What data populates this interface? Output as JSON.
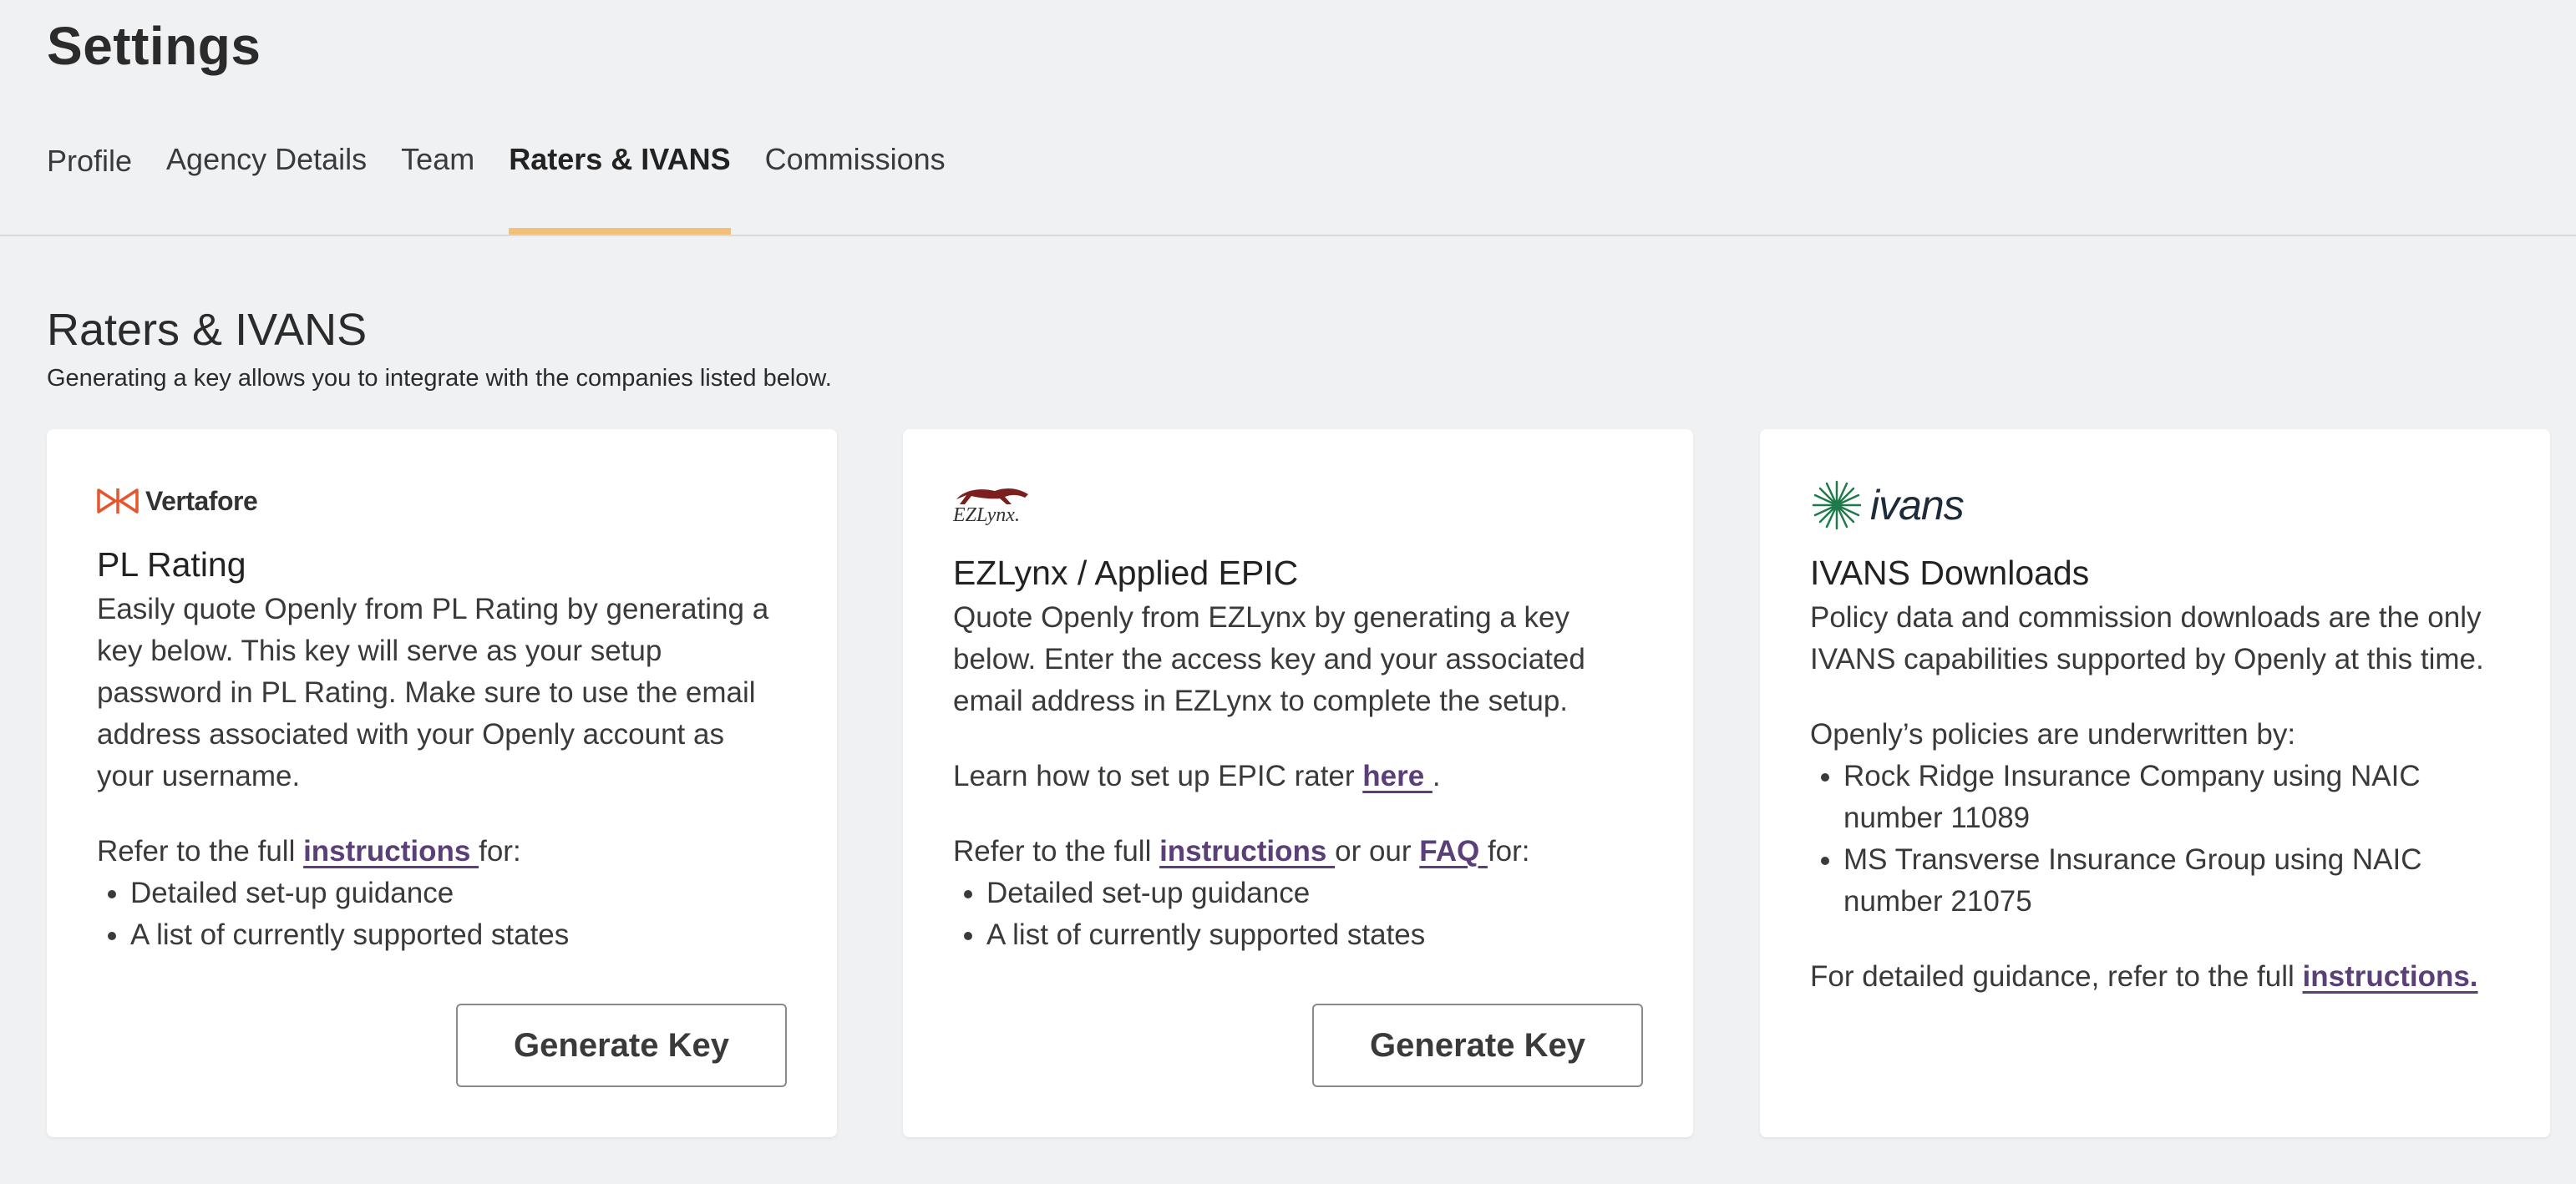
{
  "page": {
    "title": "Settings"
  },
  "tabs": [
    {
      "label": "Profile"
    },
    {
      "label": "Agency Details"
    },
    {
      "label": "Team"
    },
    {
      "label": "Raters & IVANS",
      "active": true
    },
    {
      "label": "Commissions"
    }
  ],
  "colors": {
    "active_tab_underline": "#f2c078",
    "link": "#5b3f78",
    "vertafore_orange": "#e4572e",
    "ezlynx_red": "#7a1e1e",
    "ivans_green": "#1e7a4a"
  },
  "section": {
    "title": "Raters & IVANS",
    "subtitle": "Generating a key allows you to integrate with the companies listed below."
  },
  "cards": [
    {
      "logo": {
        "icon": "vertafore-logo-icon",
        "text": "Vertafore"
      },
      "title": "PL Rating",
      "description": "Easily quote Openly from PL Rating by generating a key below. This key will serve as your setup password in PL Rating. Make sure to use the email address associated with your Openly account as your username.",
      "refer_prefix": "Refer to the full ",
      "refer_link": "instructions ",
      "refer_suffix": "for:",
      "bullets": [
        "Detailed set-up guidance",
        "A list of currently supported states"
      ],
      "button_label": "Generate Key"
    },
    {
      "logo": {
        "icon": "ezlynx-logo-icon",
        "text": "EZLynx."
      },
      "title": "EZLynx / Applied EPIC",
      "description": "Quote Openly from EZLynx by generating a key below. Enter the access key and your associated email address in EZLynx to complete the setup.",
      "learn_prefix": "Learn how to set up EPIC rater ",
      "learn_link": "here ",
      "learn_suffix": ".",
      "refer_prefix": "Refer to the full ",
      "refer_link": "instructions ",
      "refer_middle": "or our ",
      "refer_link2": "FAQ ",
      "refer_suffix": "for:",
      "bullets": [
        "Detailed set-up guidance",
        "A list of currently supported states"
      ],
      "button_label": "Generate Key"
    },
    {
      "logo": {
        "icon": "ivans-logo-icon",
        "text": "ivans"
      },
      "title": "IVANS Downloads",
      "description": "Policy data and commission downloads are the only IVANS capabilities supported by Openly at this time.",
      "underwritten_label": "Openly’s policies are underwritten by:",
      "bullets": [
        "Rock Ridge Insurance Company using NAIC number 11089",
        "MS Transverse Insurance Group using NAIC number 21075"
      ],
      "guidance_prefix": "For detailed guidance, refer to the full ",
      "guidance_link": "instructions."
    }
  ]
}
